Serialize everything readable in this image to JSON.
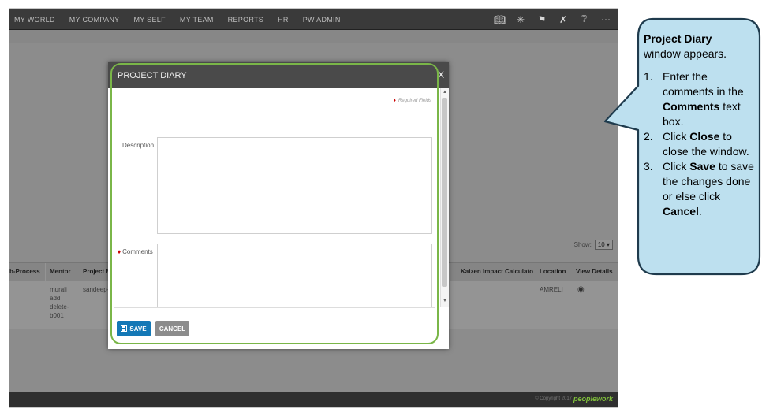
{
  "nav": {
    "items": [
      "MY WORLD",
      "MY COMPANY",
      "MY SELF",
      "MY TEAM",
      "REPORTS",
      "HR",
      "PW ADMIN"
    ],
    "icons": [
      "book-icon",
      "lightbulb-icon",
      "flag-icon",
      "tools-icon",
      "help-icon",
      "share-icon"
    ]
  },
  "table": {
    "show_label": "Show:",
    "show_value": "10 ▾",
    "columns": [
      "b-Process",
      "Mentor",
      "Project M",
      "Kaizen Impact Calculator",
      "Location",
      "View Details"
    ],
    "row": {
      "mentor": [
        "murali",
        "add",
        "delete-",
        "b001"
      ],
      "project_manager": "sandeep- ",
      "location": "AMRELI"
    }
  },
  "footer": {
    "copyright": "© Copyright 2017",
    "brand": "peoplework"
  },
  "modal": {
    "title": "PROJECT DIARY",
    "close": "X",
    "required_note": "Required Fields",
    "description_label": "Description",
    "comments_label": "Comments",
    "save_label": "SAVE",
    "cancel_label": "CANCEL"
  },
  "callout": {
    "title": "Project Diary",
    "subtitle": "window appears.",
    "steps": [
      {
        "num": "1.",
        "pre": "Enter the comments in the ",
        "bold": "Comments",
        "post": " text box."
      },
      {
        "num": "2.",
        "pre": "Click ",
        "bold": "Close",
        "post": " to close the window."
      },
      {
        "num": "3.",
        "pre": "Click ",
        "bold": "Save",
        "post": " to save the changes done or else click ",
        "bold2": "Cancel",
        "post2": "."
      }
    ]
  },
  "colors": {
    "highlight": "#7ab648",
    "callout_fill": "#bde0ef",
    "callout_border": "#1f3b4d",
    "save_button": "#1478b6"
  }
}
